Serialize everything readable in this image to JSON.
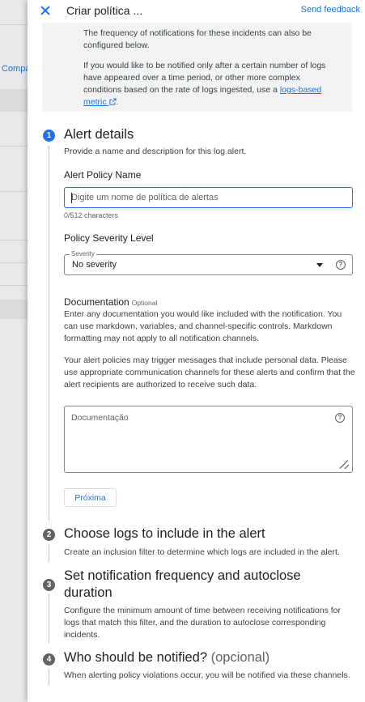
{
  "background": {
    "partial_link": "Compa"
  },
  "header": {
    "title": "Criar política ...",
    "send_feedback": "Send feedback"
  },
  "info": {
    "para1": "The frequency of notifications for these incidents can also be configured below.",
    "para2_prefix": "If you would like to be notified only after a certain number of logs have appeared over a time period, or other more complex conditions based on the rate of logs ingested, use a ",
    "para2_link": "logs-based metric",
    "para2_suffix": "."
  },
  "steps": [
    {
      "number": "1",
      "title": "Alert details",
      "description": "Provide a name and description for this log alert."
    },
    {
      "number": "2",
      "title": "Choose logs to include in the alert",
      "description": "Create an inclusion filter to determine which logs are included in the alert."
    },
    {
      "number": "3",
      "title": "Set notification frequency and autoclose duration",
      "description": "Configure the minimum amount of time between receiving notifications for logs that match this filter, and the duration to autoclose corresponding incidents."
    },
    {
      "number": "4",
      "title": "Who should be notified?",
      "title_optional": "(opcional)",
      "description": "When alerting policy violations occur, you will be notified via these channels."
    }
  ],
  "form": {
    "policy_name_label": "Alert Policy Name",
    "policy_name_placeholder": "Digite um nome de política de alertas",
    "policy_name_value": "",
    "char_count": "0/512 characters",
    "severity_label": "Policy Severity Level",
    "severity_field_label": "Severity",
    "severity_value": "No severity",
    "documentation_label": "Documentation",
    "documentation_optional": "Optional",
    "documentation_help": "Enter any documentation you would like included with the notification. You can use markdown, variables, and channel-specific controls. Markdown formatting may not apply to all notification channels.",
    "documentation_privacy": "Your alert policies may trigger messages that include personal data. Please use appropriate communication channels for these alerts and confirm that the alert recipients are authorized to receive such data.",
    "documentation_placeholder": "Documentação",
    "next_button": "Próxima"
  },
  "colors": {
    "accent": "#1a73e8",
    "inactive_step": "#5f6368"
  }
}
